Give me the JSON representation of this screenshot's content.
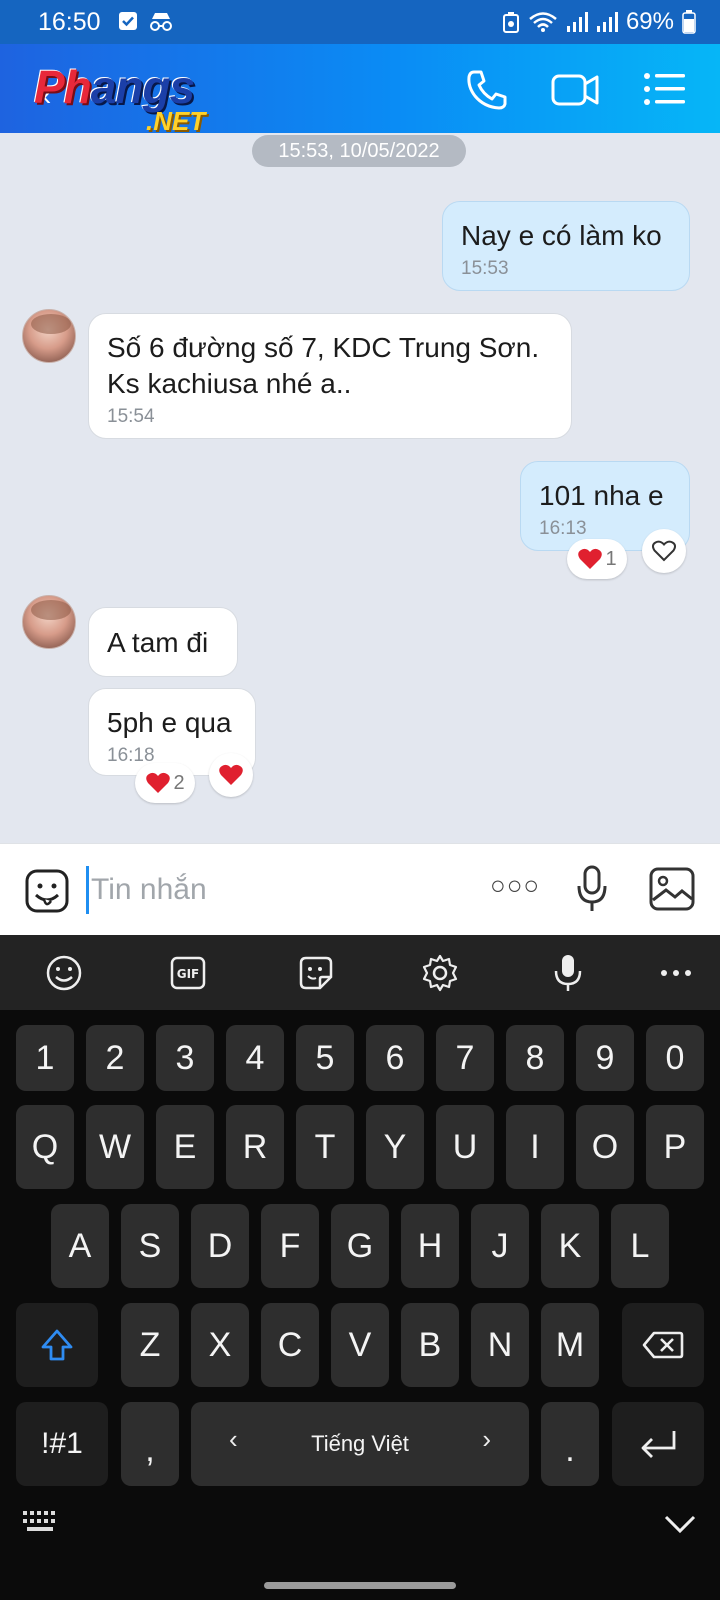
{
  "status_bar": {
    "time": "16:50",
    "battery": "69%"
  },
  "header": {
    "logo_main_red": "Ph",
    "logo_main_blue": "angs",
    "logo_net": ".NET"
  },
  "chat": {
    "date": "15:53, 10/05/2022",
    "messages": [
      {
        "text": "Nay e có làm ko",
        "time": "15:53"
      },
      {
        "text_line1": "Số 6 đường số 7, KDC Trung Sơn.",
        "text_line2": "Ks kachiusa nhé a..",
        "time": "15:54"
      },
      {
        "text": "101 nha e",
        "time": "16:13",
        "reaction_count": "1"
      },
      {
        "text": "A tam đi"
      },
      {
        "text": "5ph e qua",
        "time": "16:18",
        "reaction_count": "2"
      }
    ]
  },
  "composer": {
    "placeholder": "Tin nhắn",
    "more": "○○○"
  },
  "keyboard": {
    "numbers": [
      "1",
      "2",
      "3",
      "4",
      "5",
      "6",
      "7",
      "8",
      "9",
      "0"
    ],
    "row1": [
      "Q",
      "W",
      "E",
      "R",
      "T",
      "Y",
      "U",
      "I",
      "O",
      "P"
    ],
    "row2": [
      "A",
      "S",
      "D",
      "F",
      "G",
      "H",
      "J",
      "K",
      "L"
    ],
    "row3": [
      "Z",
      "X",
      "C",
      "V",
      "B",
      "N",
      "M"
    ],
    "symbols_key": "!#1",
    "comma": ",",
    "space_label": "Tiếng Việt",
    "period": ".",
    "space_left": "‹",
    "space_right": "›"
  },
  "colors": {
    "header_start": "#1e63e0",
    "header_end": "#06b6f7",
    "my_bubble": "#d4ecfd",
    "heart": "#e0202f"
  }
}
